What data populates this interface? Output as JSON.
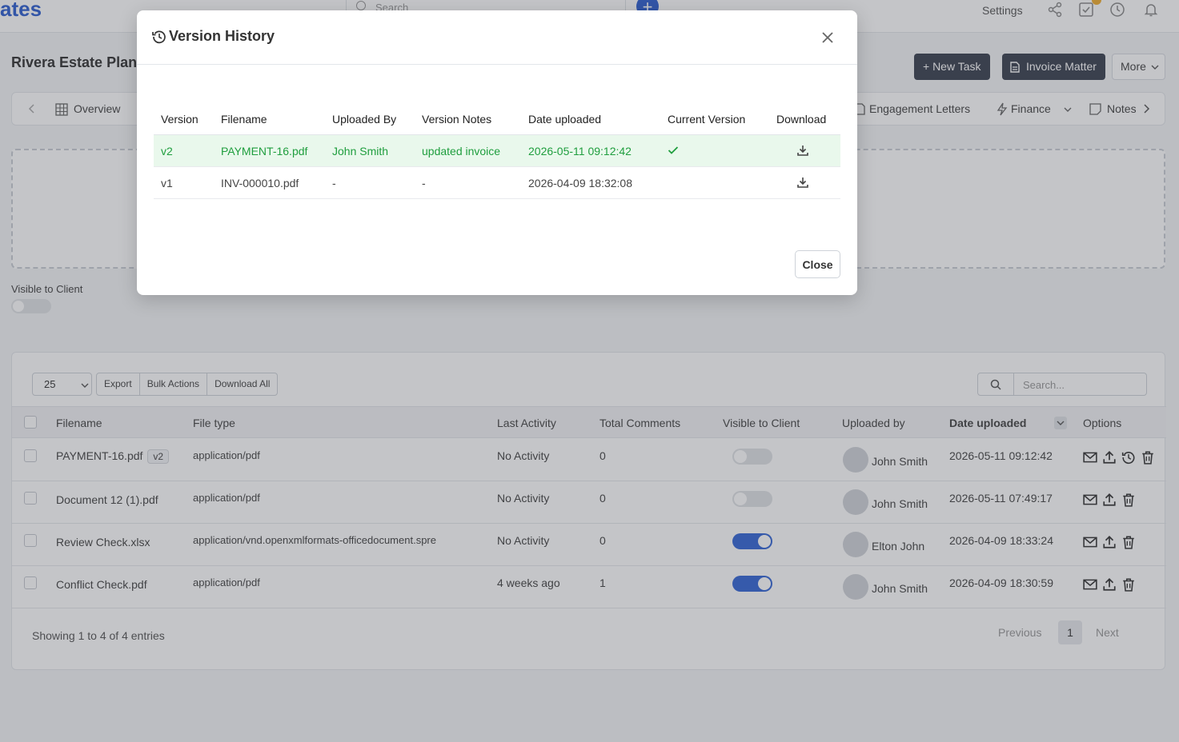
{
  "app": {
    "brand": "ates",
    "search_placeholder": "Search",
    "settings_label": "Settings"
  },
  "matter": {
    "title": "Rivera Estate Plan"
  },
  "header_buttons": {
    "new_task": "+ New Task",
    "invoice_matter": "Invoice Matter",
    "more": "More"
  },
  "tabs": [
    {
      "label": "Overview",
      "icon": "grid-icon"
    },
    {
      "label": "Engagement Letters",
      "icon": "document-icon"
    },
    {
      "label": "Finance",
      "icon": "bolt-icon"
    },
    {
      "label": "Notes",
      "icon": "note-icon"
    }
  ],
  "visible_to_client_label": "Visible to Client",
  "table": {
    "page_size": "25",
    "toolbar": {
      "export": "Export",
      "bulk_actions": "Bulk Actions",
      "download_all": "Download All"
    },
    "search_placeholder": "Search...",
    "columns": [
      "Filename",
      "File type",
      "Last Activity",
      "Total Comments",
      "Visible to Client",
      "Uploaded by",
      "Date uploaded",
      "Options"
    ],
    "rows": [
      {
        "filename": "PAYMENT-16.pdf",
        "version_tag": "v2",
        "file_type": "application/pdf",
        "last_activity": "No Activity",
        "comments": "0",
        "visible": false,
        "uploaded_by": "John Smith",
        "date": "2026-05-11 09:12:42",
        "has_history": true
      },
      {
        "filename": "Document 12 (1).pdf",
        "version_tag": "",
        "file_type": "application/pdf",
        "last_activity": "No Activity",
        "comments": "0",
        "visible": false,
        "uploaded_by": "John Smith",
        "date": "2026-05-11 07:49:17",
        "has_history": false
      },
      {
        "filename": "Review Check.xlsx",
        "version_tag": "",
        "file_type": "application/vnd.openxmlformats-officedocument.spre",
        "last_activity": "No Activity",
        "comments": "0",
        "visible": true,
        "uploaded_by": "Elton John",
        "date": "2026-04-09 18:33:24",
        "has_history": false
      },
      {
        "filename": "Conflict Check.pdf",
        "version_tag": "",
        "file_type": "application/pdf",
        "last_activity": "4 weeks ago",
        "comments": "1",
        "visible": true,
        "uploaded_by": "John Smith",
        "date": "2026-04-09 18:30:59",
        "has_history": false
      }
    ],
    "footer": {
      "showing": "Showing 1 to 4 of 4 entries",
      "previous": "Previous",
      "page": "1",
      "next": "Next"
    }
  },
  "modal": {
    "title": "Version History",
    "columns": [
      "Version",
      "Filename",
      "Uploaded By",
      "Version Notes",
      "Date uploaded",
      "Current Version",
      "Download"
    ],
    "rows": [
      {
        "version": "v2",
        "filename": "PAYMENT-16.pdf",
        "uploaded_by": "John Smith",
        "notes": "updated invoice",
        "date": "2026-05-11 09:12:42",
        "current": true
      },
      {
        "version": "v1",
        "filename": "INV-000010.pdf",
        "uploaded_by": "-",
        "notes": "-",
        "date": "2026-04-09 18:32:08",
        "current": false
      }
    ],
    "close_label": "Close"
  },
  "colors": {
    "accent": "#3466d6",
    "dark_button": "#3a4150",
    "current_row_bg": "#e9f8ec",
    "current_row_text": "#1f9e3e"
  }
}
